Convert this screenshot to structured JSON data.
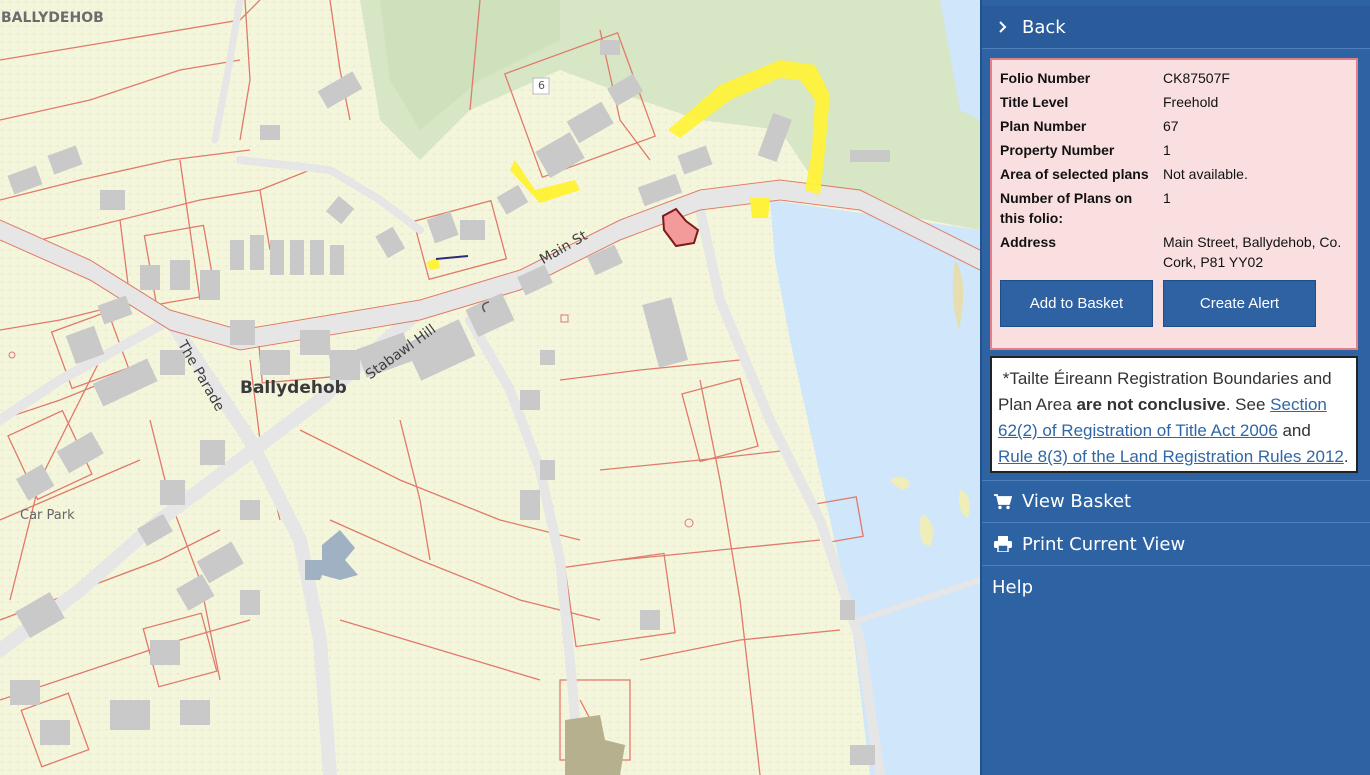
{
  "map": {
    "labels": {
      "corner": "BALLYDEHOB",
      "town": "Ballydehob",
      "main_st": "Main St",
      "the_parade": "The Parade",
      "stabawl_hill": "Stabawl Hill",
      "car_park": "Car Park",
      "house_number": "6"
    },
    "colors": {
      "land": "#f4f6dc",
      "parcel_line": "#e07a6a",
      "road": "#ededed",
      "building": "#c9c9c9",
      "water": "#cfe6fb",
      "woodland": "#d6e6c3",
      "highlight_yellow": "#fff23a",
      "selected_plan": "#f39a9a"
    }
  },
  "panel": {
    "back_label": "Back",
    "folio": [
      {
        "key": "Folio Number",
        "value": "CK87507F"
      },
      {
        "key": "Title Level",
        "value": "Freehold"
      },
      {
        "key": "Plan Number",
        "value": "67"
      },
      {
        "key": "Property Number",
        "value": "1"
      },
      {
        "key": "Area of selected plans",
        "value": "Not available."
      },
      {
        "key": "Number of Plans on this folio:",
        "value": "1"
      },
      {
        "key": "Address",
        "value": "Main Street, Ballydehob, Co. Cork, P81 YY02"
      }
    ],
    "add_to_basket": "Add to Basket",
    "create_alert": "Create Alert",
    "disclaimer": {
      "prefix": "*Tailte Éireann Registration Boundaries and Plan Area ",
      "bold": "are not conclusive",
      "middle": ". See ",
      "link1": "Section 62(2) of Registration of Title Act 2006",
      "and": " and ",
      "link2": "Rule 8(3) of the Land Registration Rules 2012",
      "suffix": "."
    },
    "view_basket": "View Basket",
    "print_view": "Print Current View",
    "help": "Help",
    "icons": {
      "back": "chevron-right-icon",
      "basket": "cart-icon",
      "print": "printer-icon"
    }
  }
}
